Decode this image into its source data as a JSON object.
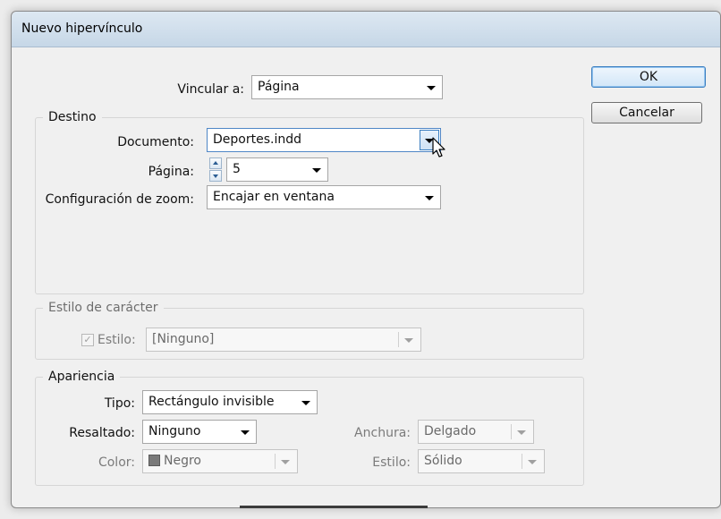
{
  "dialog": {
    "title": "Nuevo hipervínculo",
    "buttons": {
      "ok": "OK",
      "cancel": "Cancelar"
    }
  },
  "link_to": {
    "label": "Vincular a:",
    "value": "Página"
  },
  "destination": {
    "legend": "Destino",
    "document": {
      "label": "Documento:",
      "value": "Deportes.indd"
    },
    "page": {
      "label": "Página:",
      "value": "5"
    },
    "zoom": {
      "label": "Configuración de zoom:",
      "value": "Encajar en ventana"
    }
  },
  "char_style": {
    "legend": "Estilo de carácter",
    "style_checkbox_label": "Estilo:",
    "style_checked": true,
    "style_value": "[Ninguno]"
  },
  "appearance": {
    "legend": "Apariencia",
    "type": {
      "label": "Tipo:",
      "value": "Rectángulo invisible"
    },
    "highlight": {
      "label": "Resaltado:",
      "value": "Ninguno"
    },
    "color": {
      "label": "Color:",
      "value": "Negro"
    },
    "width": {
      "label": "Anchura:",
      "value": "Delgado"
    },
    "style": {
      "label": "Estilo:",
      "value": "Sólido"
    }
  },
  "icons": [
    "chevron-down-icon",
    "spinner-up-icon",
    "spinner-down-icon",
    "mouse-pointer-icon",
    "checkmark-icon",
    "color-swatch-icon"
  ],
  "colors": {
    "accent": "#3c7fc0",
    "titlebar": "#c6d7e7",
    "color_swatch": "#7a7a7a"
  }
}
